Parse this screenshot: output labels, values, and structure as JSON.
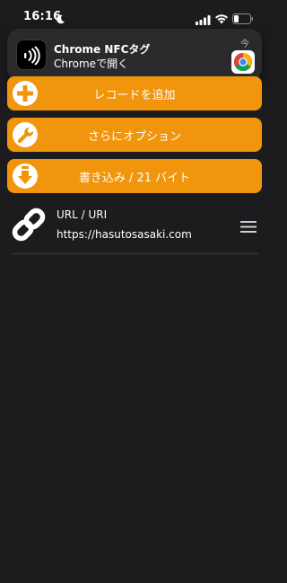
{
  "status_bar": {
    "time": "16:16"
  },
  "notification": {
    "title": "Chrome NFCタグ",
    "body": "Chromeで開く",
    "time": "今"
  },
  "actions": {
    "add_record": "レコードを追加",
    "more_options": "さらにオプション",
    "write": "書き込み / 21 バイト"
  },
  "records": [
    {
      "type": "URL / URI",
      "value": "https://hasutosasaki.com",
      "icon": "link-icon"
    }
  ],
  "colors": {
    "background": "#1c1c1e",
    "accent": "#f0950c",
    "notification": "#2a2a2c"
  }
}
